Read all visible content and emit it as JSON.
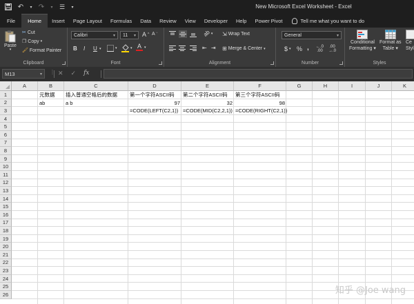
{
  "titlebar": {
    "title": "New Microsoft Excel Worksheet  -  Excel",
    "quick_access": [
      "save-icon",
      "undo-icon",
      "redo-icon",
      "customize-icon"
    ]
  },
  "tabs": [
    "File",
    "Home",
    "Insert",
    "Page Layout",
    "Formulas",
    "Data",
    "Review",
    "View",
    "Developer",
    "Help",
    "Power Pivot"
  ],
  "active_tab": "Home",
  "tell_me": "Tell me what you want to do",
  "ribbon": {
    "clipboard": {
      "paste": "Paste",
      "cut": "Cut",
      "copy": "Copy",
      "format_painter": "Format Painter",
      "label": "Clipboard"
    },
    "font": {
      "family": "Calibri",
      "size": "11",
      "bold": "B",
      "italic": "I",
      "underline": "U",
      "grow": "A",
      "shrink": "A",
      "label": "Font"
    },
    "alignment": {
      "wrap_text": "Wrap Text",
      "merge_center": "Merge & Center",
      "label": "Alignment"
    },
    "number": {
      "format": "General",
      "currency": "$",
      "percent": "%",
      "comma": ",",
      "label": "Number"
    },
    "styles": {
      "conditional": "Conditional",
      "conditional2": "Formatting",
      "format_as": "Format as",
      "format_as2": "Table",
      "cell_styles": "Ce",
      "cell_styles2": "Style",
      "label": "Styles"
    }
  },
  "formula_bar": {
    "name_box": "M13",
    "cancel": "✕",
    "enter": "✓",
    "fx": "fx",
    "value": ""
  },
  "columns": [
    "A",
    "B",
    "C",
    "D",
    "E",
    "F",
    "G",
    "H",
    "I",
    "J",
    "K"
  ],
  "rows": [
    "1",
    "2",
    "3",
    "4",
    "5",
    "6",
    "7",
    "8",
    "9",
    "10",
    "11",
    "12",
    "13",
    "14",
    "15",
    "16",
    "17",
    "18",
    "19",
    "20",
    "21",
    "22",
    "23",
    "24",
    "25",
    "26"
  ],
  "cells": {
    "B1": "元数据",
    "C1": "插入普通空格后的数据",
    "D1": "第一个字符ASCII码",
    "E1": "第二个字符ASCII码",
    "F1": "第三个字符ASCII码",
    "B2": "ab",
    "C2": "a b",
    "D2": "97",
    "E2": "32",
    "F2": "98",
    "D3": "=CODE(LEFT(C2,1))",
    "E3": "=CODE(MID(C2,2,1))",
    "F3": "=CODE(RIGHT(C2,1))"
  },
  "watermark": "知乎 @Joe wang"
}
